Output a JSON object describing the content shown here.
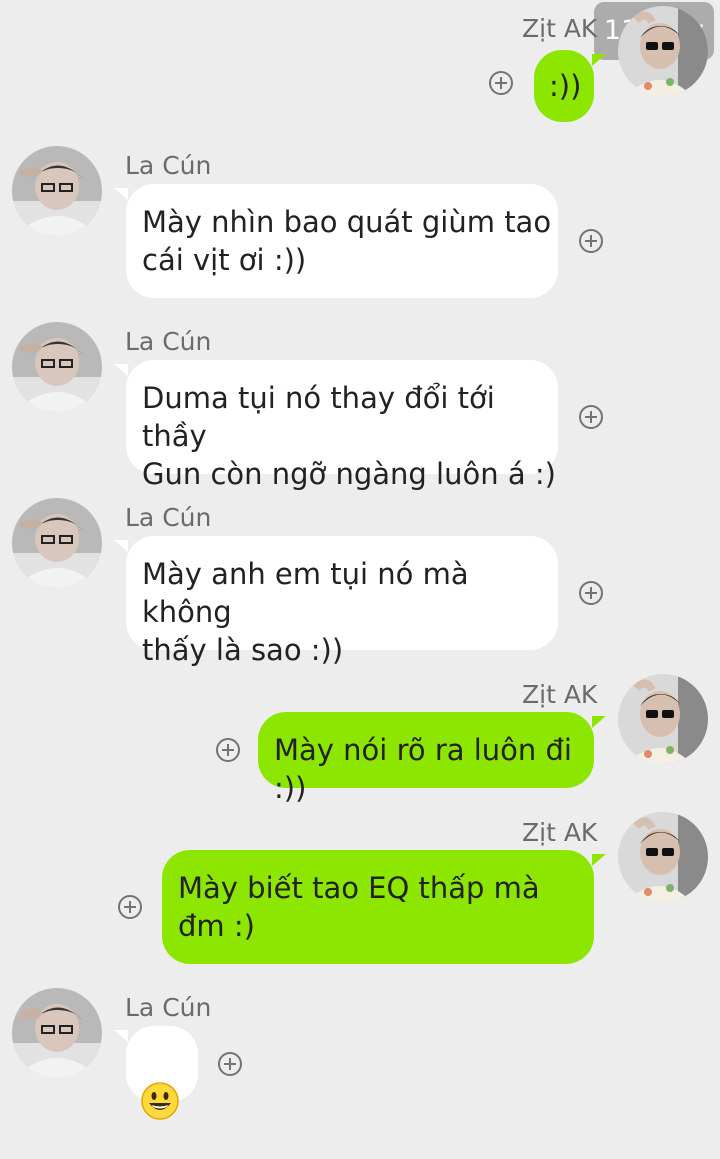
{
  "watermark": "119 joy",
  "sender_name_left": "La Cún",
  "sender_name_right": "Zịt AK",
  "messages": [
    {
      "side": "right",
      "text": ":))"
    },
    {
      "side": "left",
      "text": "Mày nhìn bao quát giùm tao\ncái vịt ơi :))"
    },
    {
      "side": "left",
      "text": "Duma tụi nó thay đổi tới thầy\nGun còn ngỡ ngàng luôn á :)"
    },
    {
      "side": "left",
      "text": "Mày anh em tụi nó mà không\nthấy là sao :))"
    },
    {
      "side": "right",
      "text": "Mày nói rõ ra luôn đi :))"
    },
    {
      "side": "right",
      "text": "Mày biết tao EQ thấp mà\nđm :)"
    },
    {
      "side": "left",
      "text": "😃"
    }
  ],
  "colors": {
    "background": "#ededed",
    "bubble_self": "#8ce600",
    "bubble_other": "#ffffff"
  },
  "icons": {
    "add": "plus-circle-icon",
    "avatar": "avatar-photo"
  }
}
